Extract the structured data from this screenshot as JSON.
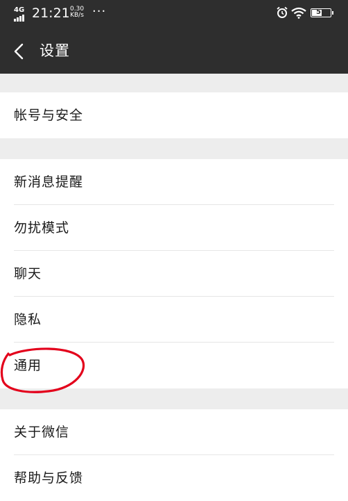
{
  "status_bar": {
    "network": "4G",
    "time": "21:21",
    "speed_value": "0.30",
    "speed_unit": "KB/s",
    "more": "···",
    "battery": "57",
    "icons": [
      "signal-icon",
      "alarm-icon",
      "wifi-icon",
      "battery-icon"
    ]
  },
  "header": {
    "title": "设置",
    "back_icon": "chevron-left-icon"
  },
  "groups": [
    {
      "items": [
        {
          "label": "帐号与安全"
        }
      ]
    },
    {
      "items": [
        {
          "label": "新消息提醒"
        },
        {
          "label": "勿扰模式"
        },
        {
          "label": "聊天"
        },
        {
          "label": "隐私"
        },
        {
          "label": "通用",
          "highlighted": true
        }
      ]
    },
    {
      "items": [
        {
          "label": "关于微信"
        },
        {
          "label": "帮助与反馈"
        }
      ]
    }
  ],
  "colors": {
    "header_bg": "#2e2e2e",
    "page_bg": "#ededed",
    "item_bg": "#ffffff",
    "annotation": "#e3001b"
  }
}
